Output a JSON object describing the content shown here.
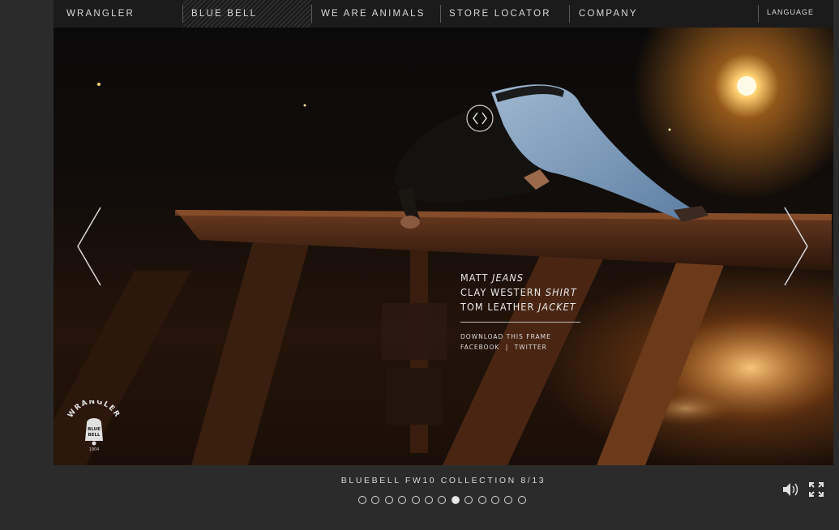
{
  "nav": {
    "items": [
      {
        "label": "WRANGLER"
      },
      {
        "label": "BLUE BELL"
      },
      {
        "label": "WE ARE ANIMALS"
      },
      {
        "label": "STORE LOCATOR"
      },
      {
        "label": "COMPANY"
      }
    ],
    "language": "LANGUAGE"
  },
  "caption": {
    "line1": {
      "name": "MATT",
      "item": "JEANS"
    },
    "line2": {
      "name": "CLAY WESTERN",
      "item": "SHIRT"
    },
    "line3": {
      "name": "TOM LEATHER",
      "item": "JACKET"
    },
    "download": "DOWNLOAD THIS FRAME",
    "facebook": "FACEBOOK",
    "separator": "|",
    "twitter": "TWITTER"
  },
  "logo": {
    "text_top": "WRANGLER",
    "text_mid1": "BLUE",
    "text_mid2": "BELL",
    "year": "1904"
  },
  "footer": {
    "collection": "BLUEBELL FW10 COLLECTION 8/13",
    "current_frame": 8,
    "total_frames": 13
  },
  "icons": {
    "prev": "chevron-left-icon",
    "next": "chevron-right-icon",
    "center": "prev-next-circle-icon",
    "sound": "speaker-icon",
    "fullscreen": "fullscreen-icon"
  },
  "colors": {
    "nav_bg": "#1b1b1b",
    "footer_bg": "#2b2b2b",
    "accent_light": "#ffd070"
  }
}
